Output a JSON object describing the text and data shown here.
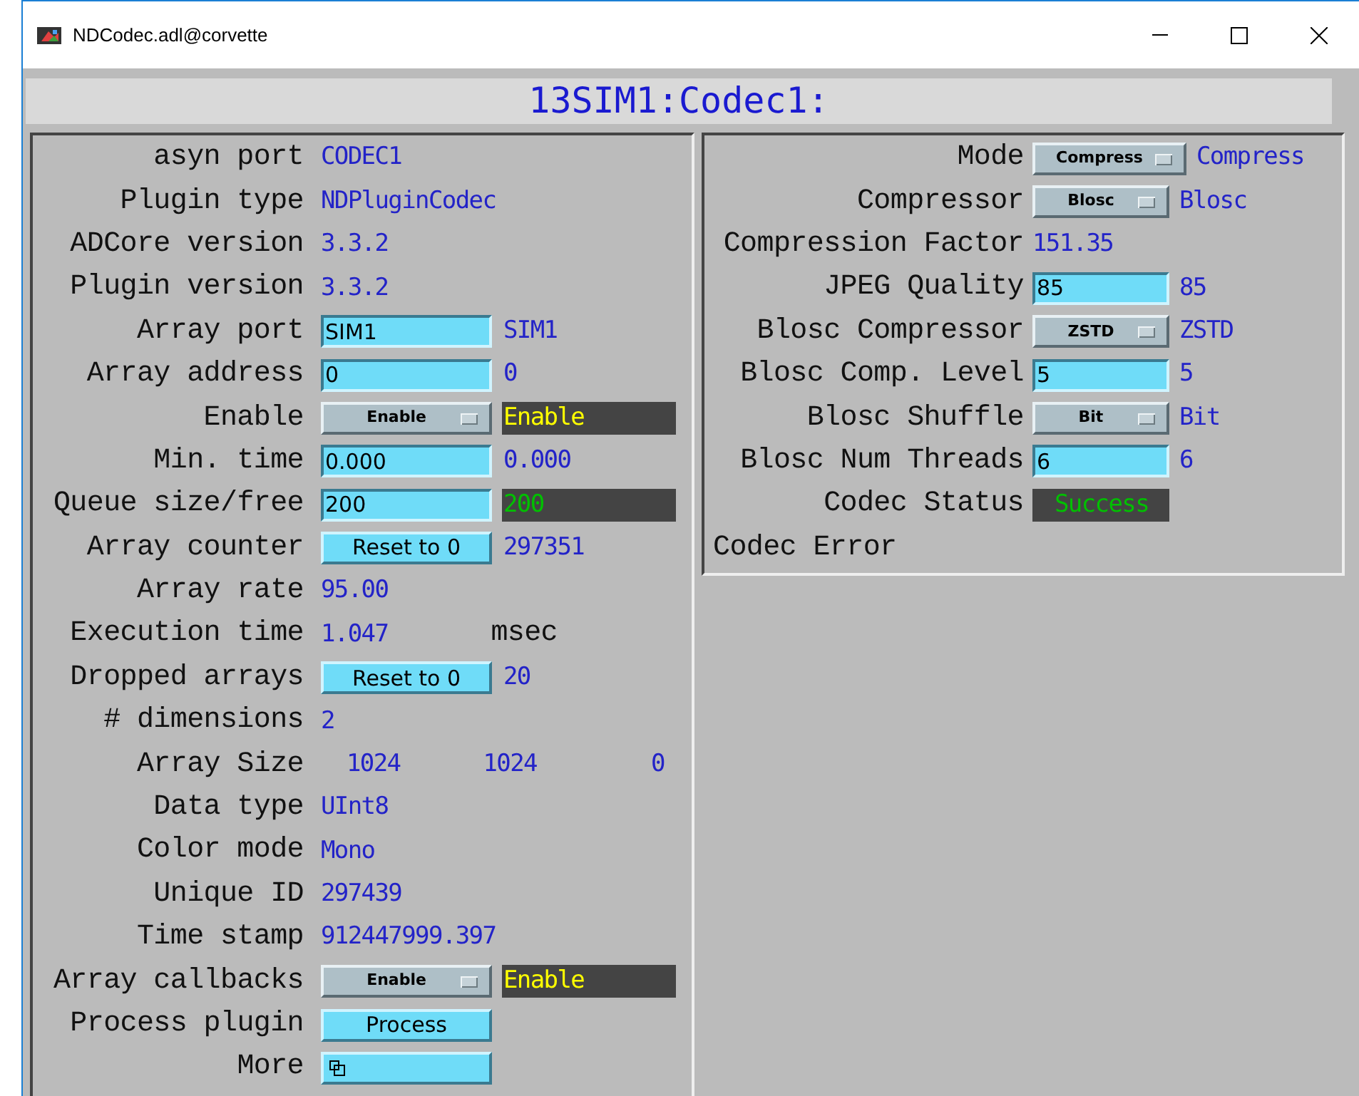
{
  "window": {
    "title": "NDCodec.adl@corvette"
  },
  "banner": "13SIM1:Codec1:",
  "left_panel": [
    {
      "kind": "readback",
      "label": "asyn port",
      "value": "CODEC1"
    },
    {
      "kind": "readback",
      "label": "Plugin type",
      "value": "NDPluginCodec"
    },
    {
      "kind": "readback",
      "label": "ADCore version",
      "value": "3.3.2"
    },
    {
      "kind": "readback",
      "label": "Plugin version",
      "value": "3.3.2"
    },
    {
      "kind": "entry",
      "label": "Array port",
      "value": "SIM1",
      "readback": "SIM1"
    },
    {
      "kind": "entry",
      "label": "Array address",
      "value": "0",
      "readback": "0"
    },
    {
      "kind": "menu",
      "label": "Enable",
      "value": "Enable",
      "readback": "Enable",
      "readback_panel": true,
      "minor_alarm": true
    },
    {
      "kind": "entry",
      "label": "Min. time",
      "value": "0.000",
      "readback": "0.000"
    },
    {
      "kind": "entry",
      "label": "Queue size/free",
      "value": "200",
      "readback": "200",
      "readback_panel": true,
      "minor_alarm": false
    },
    {
      "kind": "button",
      "label": "Array counter",
      "value": "Reset to 0",
      "readback": "297351"
    },
    {
      "kind": "readback",
      "label": "Array rate",
      "value": "95.00"
    },
    {
      "kind": "readback",
      "label": "Execution time",
      "value": "1.047",
      "unit": "msec"
    },
    {
      "kind": "button",
      "label": "Dropped arrays",
      "value": "Reset to 0",
      "readback": "20"
    },
    {
      "kind": "readback",
      "label": "# dimensions",
      "value": "2"
    },
    {
      "kind": "triple",
      "label": "Array Size",
      "values": [
        "1024",
        "1024",
        "0"
      ]
    },
    {
      "kind": "readback",
      "label": "Data type",
      "value": "UInt8"
    },
    {
      "kind": "readback",
      "label": "Color mode",
      "value": "Mono"
    },
    {
      "kind": "readback",
      "label": "Unique ID",
      "value": "297439"
    },
    {
      "kind": "readback",
      "label": "Time stamp",
      "value": "912447999.397"
    },
    {
      "kind": "menu",
      "label": "Array callbacks",
      "value": "Enable",
      "readback": "Enable",
      "readback_panel": true,
      "minor_alarm": true
    },
    {
      "kind": "button",
      "label": "Process plugin",
      "value": "Process"
    },
    {
      "kind": "related",
      "label": "More"
    }
  ],
  "right_panel": [
    {
      "kind": "menu",
      "label": "Mode",
      "value": "Compress",
      "readback": "Compress",
      "wide": true
    },
    {
      "kind": "menu",
      "label": "Compressor",
      "value": "Blosc",
      "readback": "Blosc"
    },
    {
      "kind": "readback",
      "label": "Compression Factor",
      "value": "151.35"
    },
    {
      "kind": "entry",
      "label": "JPEG Quality",
      "value": "85",
      "readback": "85"
    },
    {
      "kind": "menu",
      "label": "Blosc Compressor",
      "value": "ZSTD",
      "readback": "ZSTD"
    },
    {
      "kind": "entry",
      "label": "Blosc Comp. Level",
      "value": "5",
      "readback": "5"
    },
    {
      "kind": "menu",
      "label": "Blosc Shuffle",
      "value": "Bit",
      "readback": "Bit"
    },
    {
      "kind": "entry",
      "label": "Blosc Num Threads",
      "value": "6",
      "readback": "6"
    },
    {
      "kind": "status",
      "label": "Codec Status",
      "value": "Success",
      "minor_alarm": false
    },
    {
      "kind": "label_only",
      "label": "Codec Error"
    }
  ]
}
